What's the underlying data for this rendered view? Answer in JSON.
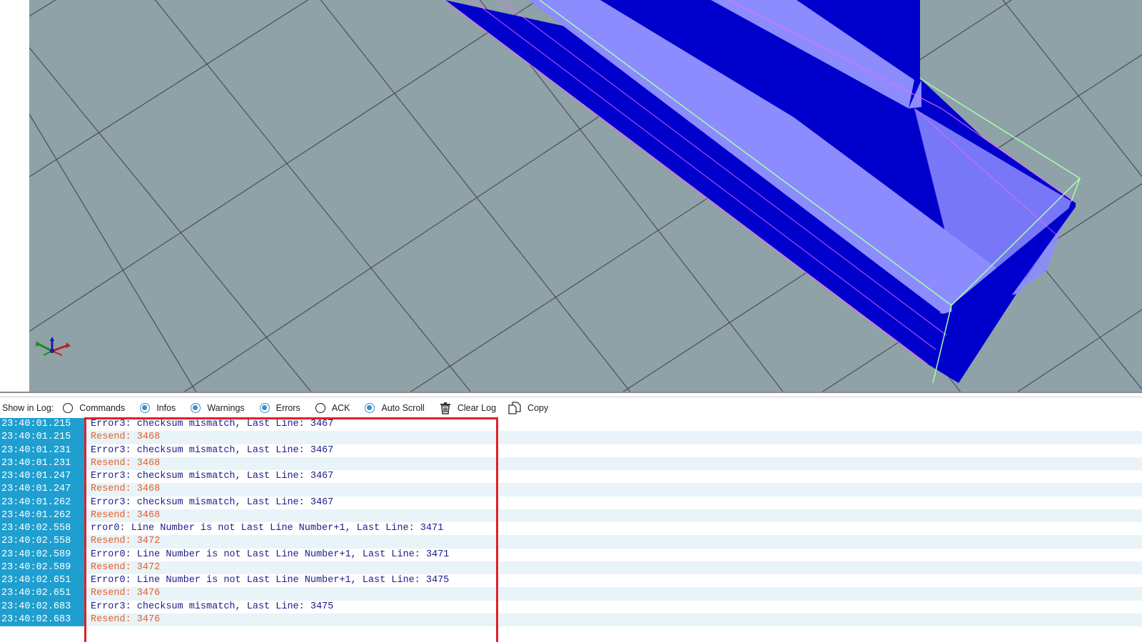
{
  "toolbar": {
    "show_in_log_label": "Show in Log:",
    "options": [
      {
        "label": "Commands",
        "checked": false,
        "name": "commands-radio"
      },
      {
        "label": "Infos",
        "checked": true,
        "name": "infos-radio"
      },
      {
        "label": "Warnings",
        "checked": true,
        "name": "warnings-radio"
      },
      {
        "label": "Errors",
        "checked": true,
        "name": "errors-radio"
      },
      {
        "label": "ACK",
        "checked": false,
        "name": "ack-radio"
      },
      {
        "label": "Auto Scroll",
        "checked": true,
        "name": "auto-scroll-radio"
      }
    ],
    "clear_log_label": "Clear Log",
    "clear_log_icon": "trash-icon",
    "copy_label": "Copy",
    "copy_icon": "copy-icon"
  },
  "viewport": {
    "background_color": "#8ea2a8",
    "model_color": "#0000cc",
    "model_highlight_color": "#8c8cff",
    "bounding_box_color": "#aaffaa",
    "axis_icon": "xyz-axes-icon"
  },
  "log": {
    "rows": [
      {
        "time": "23:40:01.215",
        "text": "Error3: checksum mismatch, Last Line: 3467",
        "kind": "error"
      },
      {
        "time": "23:40:01.215",
        "text": "Resend: 3468",
        "kind": "resend"
      },
      {
        "time": "23:40:01.231",
        "text": "Error3: checksum mismatch, Last Line: 3467",
        "kind": "error"
      },
      {
        "time": "23:40:01.231",
        "text": "Resend: 3468",
        "kind": "resend"
      },
      {
        "time": "23:40:01.247",
        "text": "Error3: checksum mismatch, Last Line: 3467",
        "kind": "error"
      },
      {
        "time": "23:40:01.247",
        "text": "Resend: 3468",
        "kind": "resend"
      },
      {
        "time": "23:40:01.262",
        "text": "Error3: checksum mismatch, Last Line: 3467",
        "kind": "error"
      },
      {
        "time": "23:40:01.262",
        "text": "Resend: 3468",
        "kind": "resend"
      },
      {
        "time": "23:40:02.558",
        "text": "rror0: Line Number is not Last Line Number+1, Last Line: 3471",
        "kind": "error"
      },
      {
        "time": "23:40:02.558",
        "text": "Resend: 3472",
        "kind": "resend"
      },
      {
        "time": "23:40:02.589",
        "text": "Error0: Line Number is not Last Line Number+1, Last Line: 3471",
        "kind": "error"
      },
      {
        "time": "23:40:02.589",
        "text": "Resend: 3472",
        "kind": "resend"
      },
      {
        "time": "23:40:02.651",
        "text": "Error0: Line Number is not Last Line Number+1, Last Line: 3475",
        "kind": "error"
      },
      {
        "time": "23:40:02.651",
        "text": "Resend: 3476",
        "kind": "resend"
      },
      {
        "time": "23:40:02.683",
        "text": "Error3: checksum mismatch, Last Line: 3475",
        "kind": "error"
      },
      {
        "time": "23:40:02.683",
        "text": "Resend: 3476",
        "kind": "resend"
      }
    ]
  }
}
